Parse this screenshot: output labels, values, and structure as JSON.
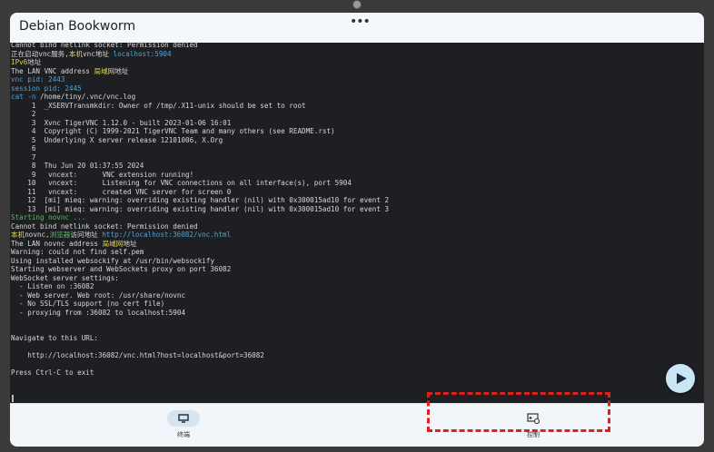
{
  "window": {
    "title": "Debian Bookworm",
    "menu": "•••"
  },
  "icons": {
    "top": "window-control-dot-icon",
    "menu": "more-dots-icon",
    "play": "play-icon",
    "terminal": "monitor-icon",
    "control": "remote-control-icon"
  },
  "colors": {
    "terminal_bg": "#1e1f22",
    "yellow": "#e4d54c",
    "green": "#5fb85f",
    "cyan": "#4fa3d8",
    "highlight_box": "#e0201a"
  },
  "terminal": {
    "lines": [
      [
        [
          "w",
          "Cannot bind netlink socket: Permission denied"
        ]
      ],
      [
        [
          "w",
          "正在启动vnc服务,"
        ],
        [
          "y",
          "本机"
        ],
        [
          "w",
          "vnc地址 "
        ],
        [
          "c",
          "localhost:5904"
        ]
      ],
      [
        [
          "y",
          "IPv6"
        ],
        [
          "w",
          "地址"
        ]
      ],
      [
        [
          "w",
          "The LAN VNC address "
        ],
        [
          "y",
          "局域网"
        ],
        [
          "w",
          "地址"
        ]
      ],
      [
        [
          "c",
          "vnc pid: 2443"
        ]
      ],
      [
        [
          "c",
          "session pid: 2445"
        ]
      ],
      [
        [
          "c",
          "cat -n "
        ],
        [
          "w",
          "/home/tiny/.vnc/vnc.log"
        ]
      ],
      [
        [
          "w",
          "     1  _XSERVTransmkdir: Owner of /tmp/.X11-unix should be set to root"
        ]
      ],
      [
        [
          "w",
          "     2"
        ]
      ],
      [
        [
          "w",
          "     3  Xvnc TigerVNC 1.12.0 - built 2023-01-06 16:01"
        ]
      ],
      [
        [
          "w",
          "     4  Copyright (C) 1999-2021 TigerVNC Team and many others (see README.rst)"
        ]
      ],
      [
        [
          "w",
          "     5  Underlying X server release 12101006, X.Org"
        ]
      ],
      [
        [
          "w",
          "     6"
        ]
      ],
      [
        [
          "w",
          "     7"
        ]
      ],
      [
        [
          "w",
          "     8  Thu Jun 20 01:37:55 2024"
        ]
      ],
      [
        [
          "w",
          "     9   vncext:      VNC extension running!"
        ]
      ],
      [
        [
          "w",
          "    10   vncext:      Listening for VNC connections on all interface(s), port 5904"
        ]
      ],
      [
        [
          "w",
          "    11   vncext:      created VNC server for screen 0"
        ]
      ],
      [
        [
          "w",
          "    12  [mi] mieq: warning: overriding existing handler (nil) with 0x300015ad10 for event 2"
        ]
      ],
      [
        [
          "w",
          "    13  [mi] mieq: warning: overriding existing handler (nil) with 0x300015ad10 for event 3"
        ]
      ],
      [
        [
          "g",
          "Starting novnc ..."
        ]
      ],
      [
        [
          "w",
          "Cannot bind netlink socket: Permission denied"
        ]
      ],
      [
        [
          "y",
          "本机"
        ],
        [
          "w",
          "novnc,"
        ],
        [
          "g",
          "浏览器"
        ],
        [
          "w",
          "访问地址 "
        ],
        [
          "c",
          "http://localhost:36082/vnc.html"
        ]
      ],
      [
        [
          "w",
          "The LAN novnc address "
        ],
        [
          "y",
          "局域网"
        ],
        [
          "w",
          "地址"
        ]
      ],
      [
        [
          "w",
          "Warning: could not find self.pem"
        ]
      ],
      [
        [
          "w",
          "Using installed websockify at /usr/bin/websockify"
        ]
      ],
      [
        [
          "w",
          "Starting webserver and WebSockets proxy on port 36082"
        ]
      ],
      [
        [
          "w",
          "WebSocket server settings:"
        ]
      ],
      [
        [
          "w",
          "  - Listen on :36082"
        ]
      ],
      [
        [
          "w",
          "  - Web server. Web root: /usr/share/novnc"
        ]
      ],
      [
        [
          "w",
          "  - No SSL/TLS support (no cert file)"
        ]
      ],
      [
        [
          "w",
          "  - proxying from :36082 to localhost:5904"
        ]
      ],
      [
        [
          "w",
          ""
        ]
      ],
      [
        [
          "w",
          ""
        ]
      ],
      [
        [
          "w",
          "Navigate to this URL:"
        ]
      ],
      [
        [
          "w",
          ""
        ]
      ],
      [
        [
          "w",
          "    http://localhost:36082/vnc.html?host=localhost&port=36082"
        ]
      ],
      [
        [
          "w",
          ""
        ]
      ],
      [
        [
          "w",
          "Press Ctrl-C to exit"
        ]
      ]
    ]
  },
  "bottom_nav": {
    "terminal_label": "终端",
    "control_label": "控制"
  }
}
